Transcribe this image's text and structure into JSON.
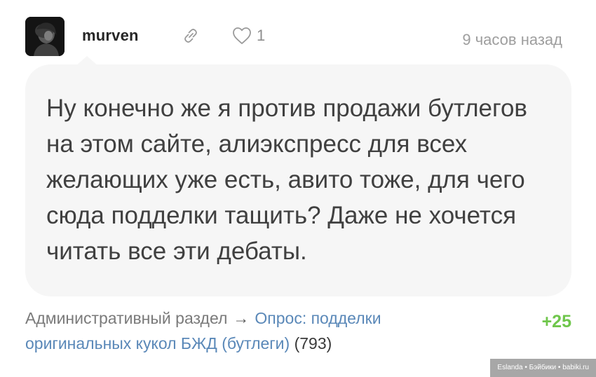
{
  "comment": {
    "author": {
      "username": "murven",
      "avatar_icon": "portrait-avatar-icon"
    },
    "actions": {
      "link_icon": "link-icon",
      "like_icon": "heart-icon",
      "like_count": "1"
    },
    "timestamp": "9 часов назад",
    "text": "Ну конечно же я против продажи бутлегов на этом сайте, алиэкспресс для всех желающих уже есть, авито тоже, для чего сюда подделки тащить? Даже не хочется читать все эти дебаты.",
    "footer": {
      "section": "Административный раздел",
      "arrow": "→",
      "topic": "Опрос: подделки оригинальных кукол БЖД (бутлеги)",
      "topic_count": "(793)"
    },
    "score": "+25"
  },
  "watermark": "Eslanda • Бэйбики • babiki.ru",
  "colors": {
    "bubble_bg": "#f6f6f6",
    "link": "#5a88b8",
    "score_positive": "#6fc64b",
    "muted_text": "#9e9e9e"
  }
}
